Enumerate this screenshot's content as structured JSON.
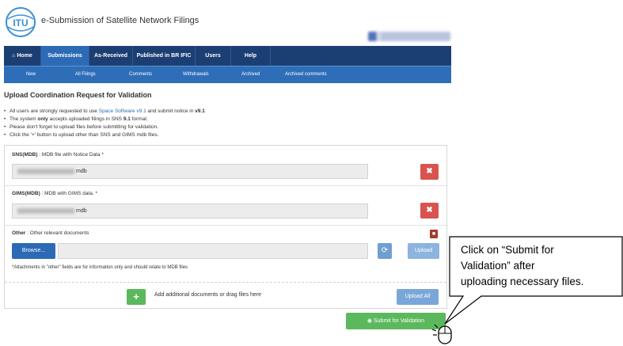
{
  "header": {
    "logo_text": "ITU",
    "title": "e-Submission of Satellite Network Filings"
  },
  "nav": {
    "items": [
      {
        "label": "Home",
        "icon": "home-icon",
        "active": false
      },
      {
        "label": "Submissions",
        "active": true
      },
      {
        "label": "As-Received",
        "active": false
      },
      {
        "label": "Published in BR IFIC",
        "active": false
      },
      {
        "label": "Users",
        "active": false
      },
      {
        "label": "Help",
        "active": false
      }
    ]
  },
  "subnav": {
    "items": [
      "New",
      "All Filings",
      "Comments",
      "Withdrawals",
      "Archived",
      "Archived comments"
    ]
  },
  "page": {
    "title": "Upload Coordination Request for Validation",
    "notes": {
      "n1_pre": "All users are strongly requested to use ",
      "n1_link": "Space Software v9.1",
      "n1_mid": " and submit notice in ",
      "n1_bold": "v9.1",
      "n2_pre": "The system ",
      "n2_bold1": "only",
      "n2_mid": " accepts uploaded filings in SNS ",
      "n2_bold2": "9.1",
      "n2_post": " format.",
      "n3": "Please don't forget to upload files before submitting for validation.",
      "n4": "Click the '+' button to upload other than SNS and GIMS mdb files."
    }
  },
  "upload": {
    "sns": {
      "label_bold": "SNS(MDB)",
      "label_rest": " : MDB file with Notice Data *",
      "file_suffix": "mdb"
    },
    "gims": {
      "label_bold": "GIMS(MDB)",
      "label_rest": " : MDB with GIMS data. *",
      "file_suffix": "mdb"
    },
    "other": {
      "label_bold": "Other",
      "label_rest": " : Other relevant documents"
    },
    "browse_label": "Browse...",
    "upload_label": "Upload",
    "attach_note": "*Attachments in \"other\" fields are for information only and should relate to MDB files",
    "add_label": "Add additional documents or drag files here",
    "upload_all_label": "Upload All",
    "remove_symbol": "✖",
    "add_symbol": "+"
  },
  "submit": {
    "label": "Submit for Validation",
    "icon": "globe-icon"
  },
  "callout": {
    "line1": "Click on “Submit for",
    "line2": "Validation” after",
    "line3": "uploading necessary files."
  },
  "colors": {
    "navbar": "#1c3f73",
    "subnav": "#2e6eb8",
    "danger": "#d9534f",
    "success": "#5cb85c",
    "primary": "#2d6ab6"
  }
}
